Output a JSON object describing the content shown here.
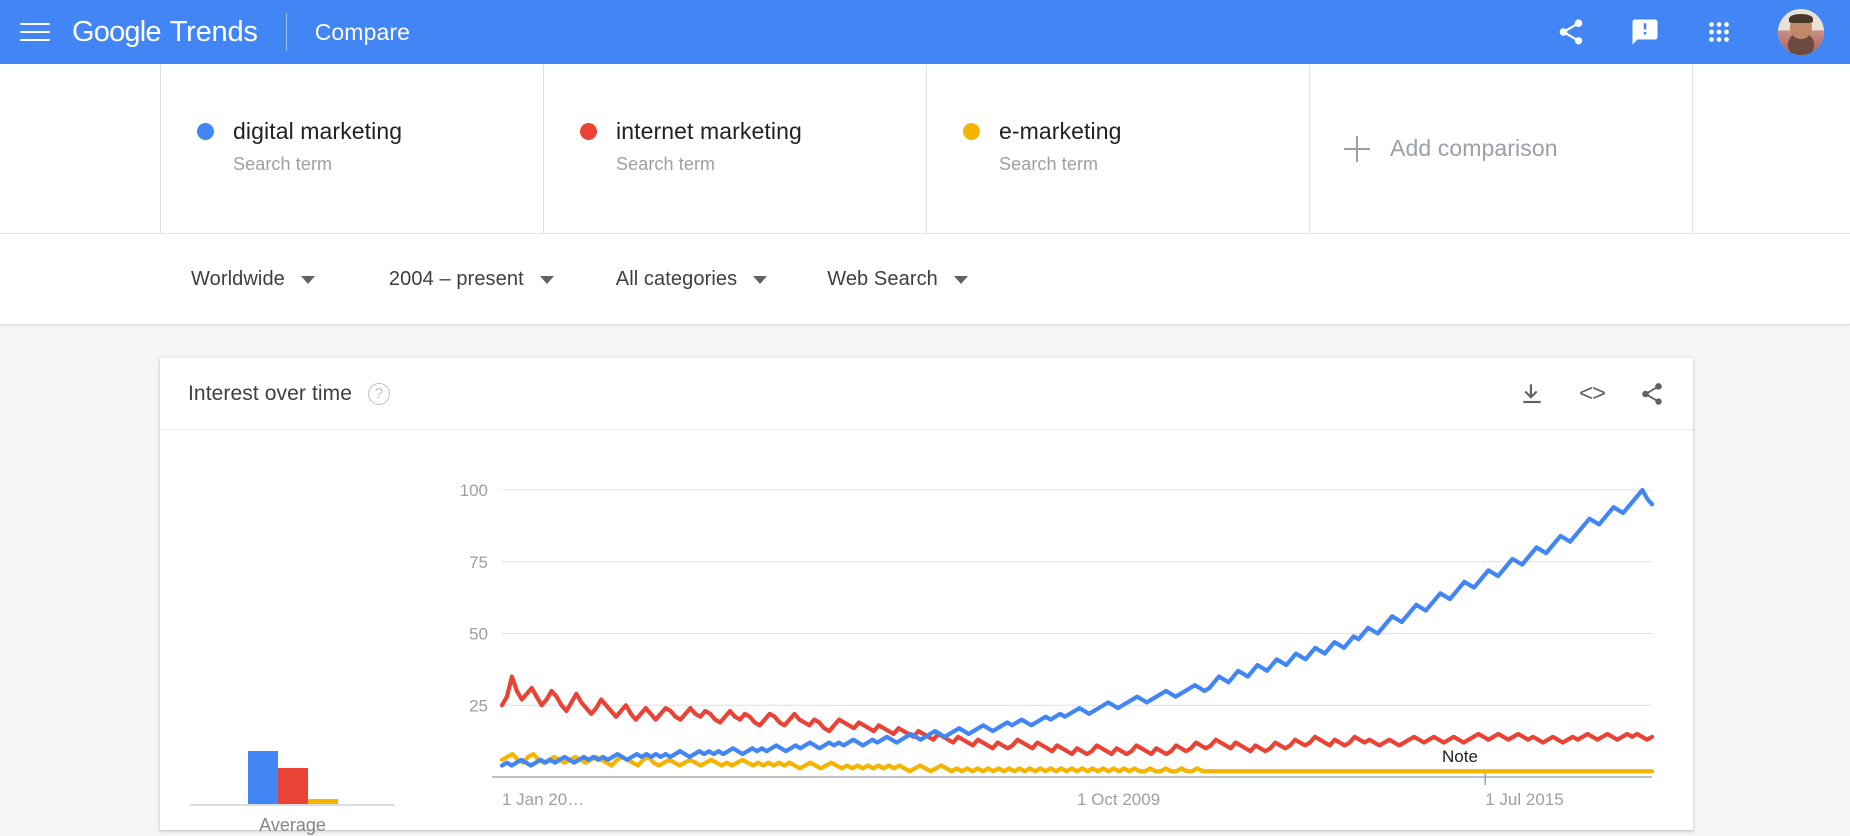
{
  "appbar": {
    "menu_icon": "hamburger-menu-icon",
    "brand_google": "Google",
    "brand_trends": "Trends",
    "section": "Compare",
    "icons": [
      {
        "name": "share-icon",
        "label": "Share"
      },
      {
        "name": "feedback-icon",
        "label": "Send feedback"
      },
      {
        "name": "apps-grid-icon",
        "label": "Google apps"
      },
      {
        "name": "avatar",
        "label": "Account"
      }
    ],
    "bg_color": "#4285F4"
  },
  "comparison": {
    "terms": [
      {
        "name": "digital marketing",
        "type": "Search term",
        "color": "#4285F4"
      },
      {
        "name": "internet marketing",
        "type": "Search term",
        "color": "#EA4335"
      },
      {
        "name": "e-marketing",
        "type": "Search term",
        "color": "#F5B400"
      }
    ],
    "add_label": "Add comparison",
    "add_icon": "plus-icon"
  },
  "filters": [
    {
      "name": "location",
      "value": "Worldwide"
    },
    {
      "name": "time-range",
      "value": "2004 – present"
    },
    {
      "name": "category",
      "value": "All categories"
    },
    {
      "name": "search-type",
      "value": "Web Search"
    }
  ],
  "chart_card": {
    "title": "Interest over time",
    "help_glyph": "?",
    "tools": [
      {
        "name": "download-icon",
        "label": "Download CSV"
      },
      {
        "name": "embed-icon",
        "label": "<>"
      },
      {
        "name": "share-icon",
        "label": "Share"
      }
    ],
    "average_label": "Average",
    "note_label": "Note"
  },
  "chart_data": {
    "type": "line",
    "title": "Interest over time",
    "xlabel": "",
    "ylabel": "",
    "ylim": [
      0,
      100
    ],
    "grid": true,
    "legend_position": "top",
    "y_ticks": [
      100,
      75,
      50,
      25
    ],
    "x_tick_labels": [
      "1 Jan 20…",
      "1 Oct 2009",
      "1 Jul 2015"
    ],
    "x_tick_positions": [
      0,
      0.5,
      0.855
    ],
    "annotations": [
      {
        "label": "Note",
        "x": 0.82
      }
    ],
    "average_bars": {
      "categories": [
        "digital marketing",
        "internet marketing",
        "e-marketing"
      ],
      "values": [
        29,
        20,
        3
      ]
    },
    "series": [
      {
        "name": "digital marketing",
        "color": "#4285F4",
        "values": [
          4,
          5,
          4,
          5,
          6,
          5,
          4,
          5,
          6,
          5,
          6,
          5,
          6,
          7,
          6,
          5,
          6,
          7,
          6,
          7,
          6,
          7,
          6,
          7,
          8,
          7,
          6,
          7,
          8,
          7,
          8,
          7,
          8,
          7,
          8,
          7,
          8,
          9,
          8,
          7,
          8,
          9,
          8,
          9,
          8,
          9,
          8,
          9,
          10,
          9,
          8,
          9,
          10,
          9,
          10,
          9,
          10,
          11,
          10,
          9,
          10,
          11,
          10,
          11,
          12,
          11,
          10,
          11,
          12,
          11,
          12,
          11,
          12,
          13,
          12,
          11,
          12,
          13,
          12,
          13,
          14,
          13,
          12,
          13,
          14,
          15,
          14,
          13,
          14,
          15,
          16,
          15,
          14,
          15,
          16,
          17,
          16,
          15,
          16,
          17,
          18,
          17,
          16,
          17,
          18,
          19,
          18,
          19,
          20,
          19,
          18,
          19,
          20,
          21,
          20,
          21,
          22,
          21,
          22,
          23,
          24,
          23,
          22,
          23,
          24,
          25,
          26,
          25,
          24,
          25,
          26,
          27,
          28,
          27,
          26,
          27,
          28,
          29,
          30,
          29,
          28,
          29,
          30,
          31,
          32,
          31,
          30,
          31,
          33,
          35,
          34,
          33,
          35,
          37,
          36,
          35,
          37,
          39,
          38,
          37,
          39,
          41,
          40,
          39,
          41,
          43,
          42,
          41,
          43,
          45,
          44,
          43,
          45,
          47,
          46,
          45,
          47,
          49,
          48,
          50,
          52,
          51,
          50,
          52,
          54,
          56,
          55,
          54,
          56,
          58,
          60,
          59,
          58,
          60,
          62,
          64,
          63,
          62,
          64,
          66,
          68,
          67,
          66,
          68,
          70,
          72,
          71,
          70,
          72,
          74,
          76,
          75,
          74,
          76,
          78,
          80,
          79,
          78,
          80,
          82,
          84,
          83,
          82,
          84,
          86,
          88,
          90,
          89,
          88,
          90,
          92,
          94,
          93,
          92,
          94,
          96,
          98,
          100,
          97,
          95
        ]
      },
      {
        "name": "internet marketing",
        "color": "#EA4335",
        "values": [
          25,
          28,
          35,
          30,
          27,
          29,
          31,
          28,
          25,
          27,
          30,
          28,
          25,
          23,
          26,
          29,
          26,
          24,
          22,
          24,
          27,
          25,
          23,
          21,
          23,
          25,
          22,
          20,
          22,
          24,
          22,
          20,
          22,
          24,
          23,
          21,
          20,
          22,
          24,
          22,
          21,
          23,
          22,
          20,
          19,
          21,
          23,
          21,
          20,
          22,
          21,
          19,
          18,
          20,
          22,
          21,
          19,
          18,
          20,
          22,
          20,
          19,
          18,
          20,
          19,
          17,
          16,
          18,
          20,
          19,
          18,
          17,
          19,
          18,
          17,
          16,
          18,
          17,
          16,
          15,
          17,
          16,
          15,
          14,
          16,
          15,
          14,
          13,
          15,
          14,
          13,
          12,
          14,
          13,
          12,
          11,
          13,
          12,
          11,
          10,
          12,
          11,
          10,
          11,
          13,
          12,
          11,
          10,
          12,
          11,
          10,
          9,
          11,
          10,
          9,
          8,
          10,
          9,
          8,
          9,
          11,
          10,
          9,
          8,
          10,
          9,
          8,
          9,
          11,
          10,
          9,
          8,
          10,
          9,
          8,
          9,
          11,
          10,
          9,
          10,
          12,
          11,
          10,
          11,
          13,
          12,
          11,
          10,
          12,
          11,
          10,
          9,
          11,
          10,
          9,
          10,
          12,
          11,
          10,
          11,
          13,
          12,
          11,
          12,
          14,
          13,
          12,
          11,
          13,
          12,
          11,
          12,
          14,
          13,
          12,
          13,
          12,
          11,
          12,
          13,
          12,
          11,
          12,
          13,
          14,
          13,
          12,
          13,
          14,
          13,
          12,
          13,
          14,
          13,
          12,
          13,
          14,
          15,
          14,
          13,
          14,
          15,
          14,
          13,
          14,
          15,
          14,
          13,
          14,
          13,
          12,
          13,
          14,
          13,
          12,
          13,
          14,
          13,
          14,
          15,
          14,
          13,
          14,
          15,
          14,
          13,
          14,
          15,
          14,
          15,
          14,
          13,
          14
        ]
      },
      {
        "name": "e-marketing",
        "color": "#F5B400",
        "values": [
          6,
          7,
          8,
          6,
          5,
          7,
          8,
          6,
          5,
          6,
          7,
          6,
          5,
          6,
          7,
          6,
          5,
          6,
          7,
          6,
          5,
          4,
          6,
          7,
          6,
          5,
          4,
          6,
          7,
          5,
          4,
          5,
          6,
          5,
          4,
          5,
          6,
          5,
          4,
          5,
          6,
          5,
          4,
          5,
          4,
          5,
          6,
          5,
          4,
          5,
          4,
          5,
          4,
          5,
          4,
          5,
          4,
          3,
          4,
          5,
          4,
          3,
          4,
          5,
          4,
          3,
          4,
          3,
          4,
          3,
          4,
          3,
          4,
          3,
          4,
          3,
          4,
          3,
          2,
          3,
          4,
          3,
          2,
          3,
          4,
          3,
          2,
          3,
          2,
          3,
          2,
          3,
          2,
          3,
          2,
          3,
          2,
          3,
          2,
          3,
          2,
          3,
          2,
          3,
          2,
          3,
          2,
          3,
          2,
          3,
          2,
          3,
          2,
          3,
          2,
          3,
          2,
          3,
          2,
          3,
          2,
          3,
          2,
          2,
          3,
          2,
          2,
          3,
          2,
          2,
          3,
          2,
          2,
          3,
          2,
          2,
          2,
          2,
          2,
          2,
          2,
          2,
          2,
          2,
          2,
          2,
          2,
          2,
          2,
          2,
          2,
          2,
          2,
          2,
          2,
          2,
          2,
          2,
          2,
          2,
          2,
          2,
          2,
          2,
          2,
          2,
          2,
          2,
          2,
          2,
          2,
          2,
          2,
          2,
          2,
          2,
          2,
          2,
          2,
          2,
          2,
          2,
          2,
          2,
          2,
          2,
          2,
          2,
          2,
          2,
          2,
          2,
          2,
          2,
          2,
          2,
          2,
          2,
          2,
          2,
          2,
          2,
          2,
          2,
          2,
          2,
          2,
          2,
          2,
          2,
          2,
          2,
          2,
          2,
          2,
          2,
          2,
          2,
          2,
          2,
          2
        ]
      }
    ]
  }
}
